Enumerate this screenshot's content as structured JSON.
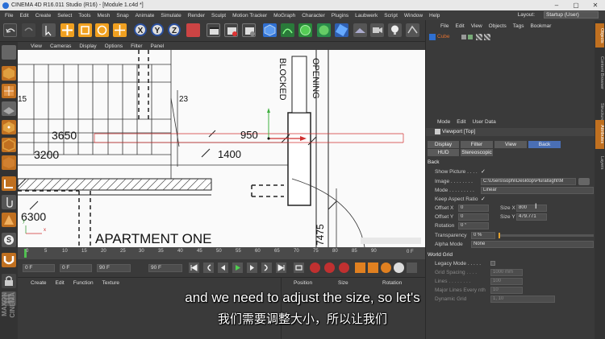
{
  "window": {
    "title": "CINEMA 4D R16.011 Studio (R16) - [Module 1.c4d *]",
    "controls": [
      "–",
      "▢",
      "✕"
    ]
  },
  "menu": [
    "File",
    "Edit",
    "Create",
    "Select",
    "Tools",
    "Mesh",
    "Snap",
    "Animate",
    "Simulate",
    "Render",
    "Sculpt",
    "Motion Tracker",
    "MoGraph",
    "Character",
    "Plugins",
    "Laubwerk",
    "Script",
    "Window",
    "Help"
  ],
  "layout": {
    "label": "Layout:",
    "value": "Startup (User)"
  },
  "toolbar": {
    "x": "X",
    "y": "Y",
    "z": "Z"
  },
  "viewport": {
    "menu": [
      "View",
      "Cameras",
      "Display",
      "Options",
      "Filter",
      "Panel"
    ],
    "labels": {
      "n15": "15",
      "n23": "23",
      "d3650": "3650",
      "d3200": "3200",
      "d950": "950",
      "d1400": "1400",
      "d6300": "6300",
      "d7475": "7475",
      "apartment": "APARTMENT ONE",
      "opening": "OPENING",
      "blocked": "BLOCKED"
    },
    "axis": {
      "y": "y",
      "x": "x"
    }
  },
  "timeline": {
    "ticks": [
      "0",
      "5",
      "10",
      "15",
      "20",
      "25",
      "30",
      "35",
      "40",
      "45",
      "50",
      "55",
      "60",
      "65",
      "70",
      "75",
      "80",
      "85",
      "90"
    ],
    "end": "0 F"
  },
  "transport": {
    "start": "0 F",
    "current": "0 F",
    "end": "90 F",
    "max": "90 F"
  },
  "material": {
    "menu": [
      "Create",
      "Edit",
      "Function",
      "Texture"
    ]
  },
  "coords": {
    "position": "Position",
    "size": "Size",
    "rotation": "Rotation"
  },
  "objects": {
    "menu": [
      "File",
      "Edit",
      "View",
      "Objects",
      "Tags",
      "Bookmar"
    ],
    "item": "Cube"
  },
  "attributes": {
    "menu": [
      "Mode",
      "Edit",
      "User Data"
    ],
    "viewport_title": "Viewport [Top]",
    "tabs": [
      "Display",
      "Filter",
      "View",
      "Back",
      "HUD",
      "Stereoscopic"
    ],
    "section_back": "Back",
    "show_picture": "Show Picture . . . .",
    "show_picture_check": "✓",
    "image_label": "Image . . . . . . . .",
    "image_value": "C:\\Users\\sophi\\Desktop\\Pluralsight\\M",
    "mode_label": "Mode . . . . . . . . .",
    "mode_value": "Linear",
    "keep_aspect": "Keep Aspect Ratio",
    "keep_aspect_check": "✓",
    "offset_x_label": "Offset X",
    "offset_x_value": "0",
    "size_x_label": "Size X",
    "size_x_value": "800",
    "offset_y_label": "Offset Y",
    "offset_y_value": "0",
    "size_y_label": "Size Y",
    "size_y_value": "479.771",
    "rotation_label": "Rotation",
    "rotation_value": "0 °",
    "transparency_label": "Transparency",
    "transparency_value": "0 %",
    "alpha_label": "Alpha Mode",
    "alpha_value": "None",
    "section_grid": "World Grid",
    "legacy": "Legacy Mode . . . . .",
    "grid_spacing": "Grid Spacing . . . .",
    "grid_spacing_value": "1000 mm",
    "lines": "Lines . . . . . . . .",
    "lines_value": "100",
    "major": "Major Lines Every nth",
    "major_value": "10",
    "dynamic": "Dynamic Grid",
    "dynamic_value": "1, 10"
  },
  "right_tabs": [
    "Objects",
    "Content Browser",
    "Structure",
    "Attributes",
    "Layers"
  ],
  "subtitles": {
    "en": "and we need to adjust the size, so let's",
    "zh": "我们需要调整大小，所以让我们"
  },
  "brand": {
    "maxon": "MAXON",
    "cinema": "CINEMA"
  }
}
